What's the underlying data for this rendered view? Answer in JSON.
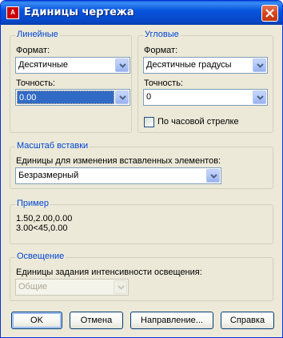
{
  "window": {
    "title": "Единицы чертежа",
    "app_icon_text": "A"
  },
  "linear": {
    "group_label": "Линейные",
    "format_label": "Формат:",
    "format_value": "Десятичные",
    "precision_label": "Точность:",
    "precision_value": "0.00"
  },
  "angular": {
    "group_label": "Угловые",
    "format_label": "Формат:",
    "format_value": "Десятичные градусы",
    "precision_label": "Точность:",
    "precision_value": "0",
    "clockwise_label": "По часовой стрелке",
    "clockwise_checked": false
  },
  "insert_scale": {
    "group_label": "Масштаб вставки",
    "units_label": "Единицы для изменения вставленных элементов:",
    "units_value": "Безразмерный"
  },
  "sample": {
    "group_label": "Пример",
    "line1": "1.50,2.00,0.00",
    "line2": "3.00<45,0.00"
  },
  "lighting": {
    "group_label": "Освещение",
    "units_label": "Единицы задания интенсивности освещения:",
    "units_value": "Общие"
  },
  "buttons": {
    "ok": "OK",
    "cancel": "Отмена",
    "direction": "Направление...",
    "help": "Справка"
  },
  "colors": {
    "titlebar": "#0855dd",
    "group_label": "#0046d5",
    "selection": "#316ac5",
    "dialog_bg": "#ece9d8"
  }
}
